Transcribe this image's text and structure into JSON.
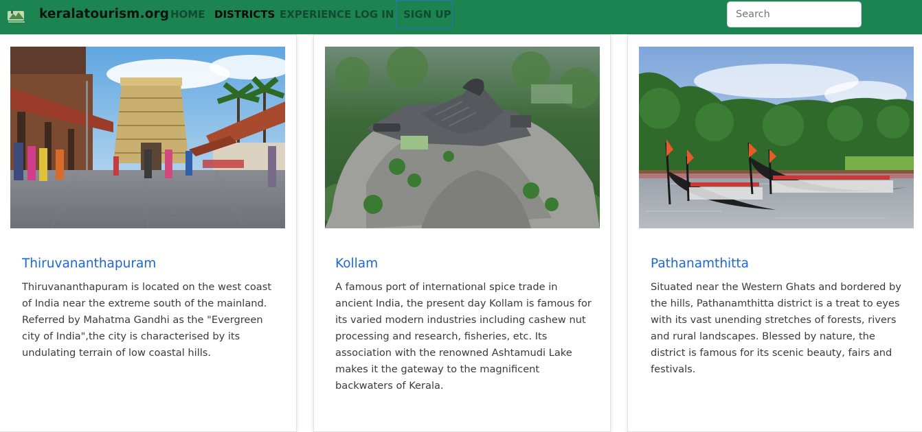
{
  "navbar": {
    "brand": "keralatourism.org",
    "links": [
      {
        "label": "HOME"
      },
      {
        "label": "DISTRICTS"
      },
      {
        "label": "EXPERIENCE"
      },
      {
        "label": "LOG IN"
      }
    ],
    "signup_label": "SIGN UP",
    "search_placeholder": "Search",
    "bg_color": "#1b8451"
  },
  "cards": [
    {
      "title": "Thiruvananthapuram",
      "text": "Thiruvananthapuram is located on the west coast of India near the extreme south of the mainland. Referred by Mahatma Gandhi as the \"Evergreen city of India\",the city is characterised by its undulating terrain of low coastal hills.",
      "image": "temple-street-photo"
    },
    {
      "title": "Kollam",
      "text": "A famous port of international spice trade in ancient India, the present day Kollam is famous for its varied modern industries including cashew nut processing and research, fisheries, etc. Its association with the renowned Ashtamudi Lake makes it the gateway to the magnificent backwaters of Kerala.",
      "image": "eagle-rock-aerial-photo"
    },
    {
      "title": "Pathanamthitta",
      "text": "Situated near the Western Ghats and bordered by the hills, Pathanamthitta district is a treat to eyes with its vast unending stretches of forests, rivers and rural landscapes. Blessed by nature, the district is famous for its scenic beauty, fairs and festivals.",
      "image": "snake-boat-race-photo"
    }
  ]
}
